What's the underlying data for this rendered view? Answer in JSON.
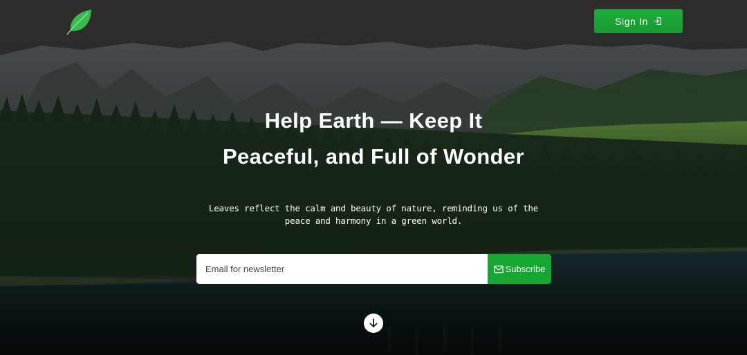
{
  "header": {
    "logo_icon": "leaf-icon",
    "signin_label": "Sign In",
    "signin_icon": "sign-in-icon"
  },
  "hero": {
    "title_line1": "Help Earth — Keep It",
    "title_line2": "Peaceful, and Full of Wonder",
    "subtitle": "Leaves reflect the calm and beauty of nature, reminding us of the peace and harmony in a green world."
  },
  "newsletter": {
    "placeholder": "Email for newsletter",
    "subscribe_label": "Subscribe",
    "subscribe_icon": "envelope-icon"
  },
  "scroll": {
    "icon": "arrow-down-icon"
  },
  "colors": {
    "accent_green": "#17a534",
    "header_bg": "#2f2d2b",
    "leaf_green": "#34b34a"
  }
}
